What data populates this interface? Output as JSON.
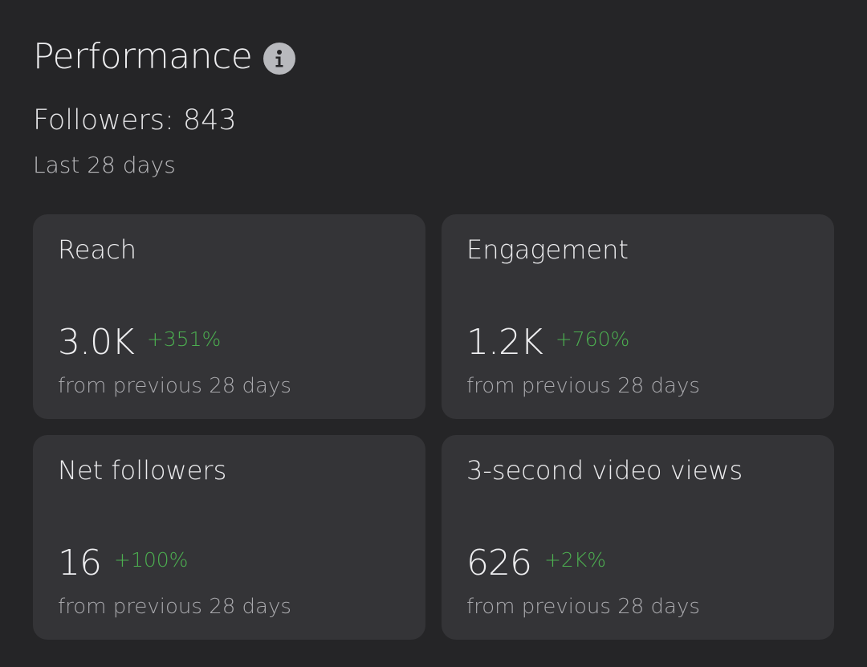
{
  "header": {
    "title": "Performance",
    "info_icon": "info-icon"
  },
  "summary": {
    "followers": "Followers: 843",
    "period": "Last 28 days"
  },
  "colors": {
    "background": "#252527",
    "card": "#343437",
    "positive": "#4caf50",
    "info_icon_bg": "#b8b9bd"
  },
  "cards": [
    {
      "title": "Reach",
      "value": "3.0K",
      "change": "+351%",
      "subtitle": "from previous 28 days"
    },
    {
      "title": "Engagement",
      "value": "1.2K",
      "change": "+760%",
      "subtitle": "from previous 28 days"
    },
    {
      "title": "Net followers",
      "value": "16",
      "change": "+100%",
      "subtitle": "from previous 28 days"
    },
    {
      "title": "3-second video views",
      "value": "626",
      "change": "+2K%",
      "subtitle": "from previous 28 days"
    }
  ]
}
